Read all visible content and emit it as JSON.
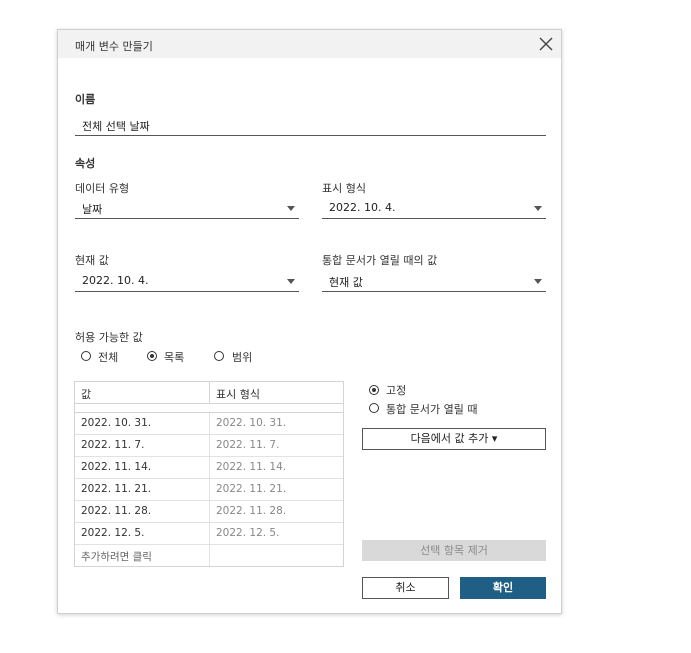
{
  "dialog": {
    "title": "매개 변수 만들기",
    "name_section": "이름",
    "name_value": "전체 선택 날짜",
    "properties_section": "속성",
    "data_type_label": "데이터 유형",
    "data_type_value": "날짜",
    "display_format_label": "표시 형식",
    "display_format_value": "2022. 10. 4.",
    "current_value_label": "현재 값",
    "current_value_value": "2022. 10. 4.",
    "workbook_open_label": "통합 문서가 열릴 때의 값",
    "workbook_open_value": "현재 값",
    "allowed_values_label": "허용 가능한 값",
    "allowed_options": [
      {
        "label": "전체",
        "selected": false
      },
      {
        "label": "목록",
        "selected": true
      },
      {
        "label": "범위",
        "selected": false
      }
    ],
    "table": {
      "headers": [
        "값",
        "표시 형식"
      ],
      "rows": [
        {
          "value": "2022. 10. 31.",
          "display": "2022. 10. 31."
        },
        {
          "value": "2022. 11. 7.",
          "display": "2022. 11. 7."
        },
        {
          "value": "2022. 11. 14.",
          "display": "2022. 11. 14."
        },
        {
          "value": "2022. 11. 21.",
          "display": "2022. 11. 21."
        },
        {
          "value": "2022. 11. 28.",
          "display": "2022. 11. 28."
        },
        {
          "value": "2022. 12. 5.",
          "display": "2022. 12. 5."
        }
      ],
      "add_placeholder": "추가하려면 클릭"
    },
    "list_mode_options": [
      {
        "label": "고정",
        "selected": true
      },
      {
        "label": "통합 문서가 열릴 때",
        "selected": false
      }
    ],
    "add_from_button": "다음에서 값 추가 ▾",
    "remove_button": "선택 항목 제거",
    "cancel_button": "취소",
    "ok_button": "확인"
  },
  "colors": {
    "primary": "#1f5f85",
    "titlebar": "#f2f2f2",
    "disabled": "#d9d9d9"
  },
  "icons": {
    "close": "close-icon",
    "dropdown": "chevron-down-icon"
  }
}
